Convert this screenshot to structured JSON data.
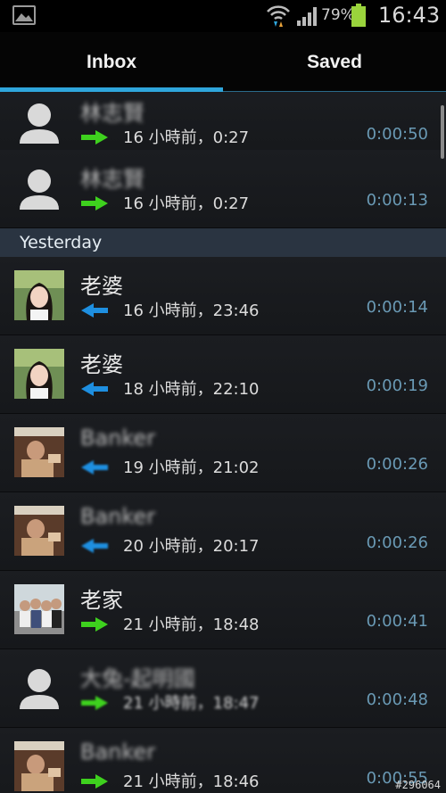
{
  "status_bar": {
    "battery_percent": "79%",
    "clock": "16:43",
    "icons": [
      "gallery-icon",
      "wifi-icon",
      "signal-icon",
      "battery-icon"
    ]
  },
  "tabs": [
    {
      "label": "Inbox",
      "selected": true
    },
    {
      "label": "Saved",
      "selected": false
    }
  ],
  "colors": {
    "accent": "#2fa6dc",
    "incoming_arrow": "#1e8fe0",
    "outgoing_arrow": "#3ed11e",
    "duration": "#6a9ab5",
    "section_bg": "#2a3441"
  },
  "calls": [
    {
      "name": "林志賢",
      "direction": "outgoing",
      "when": "16 小時前，0:27",
      "duration": "0:00:50",
      "avatar": "default",
      "blurred_name": true
    },
    {
      "name": "林志賢",
      "direction": "outgoing",
      "when": "16 小時前，0:27",
      "duration": "0:00:13",
      "avatar": "default",
      "blurred_name": true
    }
  ],
  "section_label": "Yesterday",
  "yesterday_calls": [
    {
      "name": "老婆",
      "direction": "incoming",
      "when": "16 小時前，23:46",
      "duration": "0:00:14",
      "avatar": "photo-woman",
      "blurred_name": false
    },
    {
      "name": "老婆",
      "direction": "incoming",
      "when": "18 小時前，22:10",
      "duration": "0:00:19",
      "avatar": "photo-woman",
      "blurred_name": false
    },
    {
      "name": "Banker",
      "direction": "incoming",
      "when": "19 小時前，21:02",
      "duration": "0:00:26",
      "avatar": "photo-man",
      "blurred_name": true
    },
    {
      "name": "Banker",
      "direction": "incoming",
      "when": "20 小時前，20:17",
      "duration": "0:00:26",
      "avatar": "photo-man",
      "blurred_name": true
    },
    {
      "name": "老家",
      "direction": "outgoing",
      "when": "21 小時前，18:48",
      "duration": "0:00:41",
      "avatar": "photo-family",
      "blurred_name": false
    },
    {
      "name": "大兔-起明國",
      "direction": "outgoing",
      "when": "21 小時前，18:47",
      "duration": "0:00:48",
      "avatar": "default",
      "blurred_name": true
    },
    {
      "name": "Banker",
      "direction": "outgoing",
      "when": "21 小時前，18:46",
      "duration": "0:00:55",
      "avatar": "photo-man",
      "blurred_name": true
    }
  ],
  "watermark": "#296064"
}
